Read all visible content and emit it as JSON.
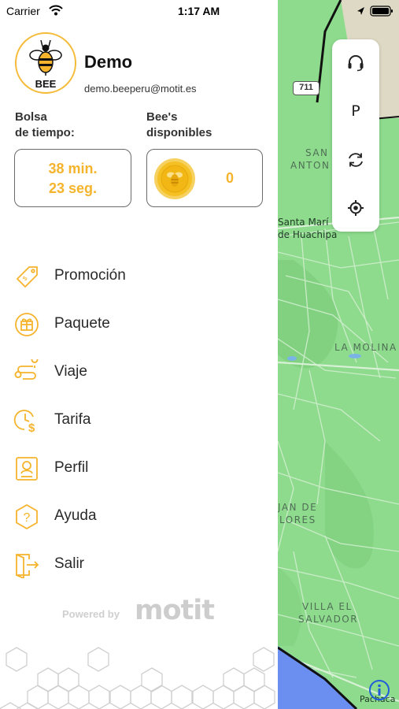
{
  "status_bar": {
    "carrier": "Carrier",
    "time": "1:17 AM"
  },
  "user": {
    "name": "Demo",
    "email": "demo.beeperu@motit.es",
    "logo_text": "BEE"
  },
  "stats": {
    "time_label_line1": "Bolsa",
    "time_label_line2": "de tiempo:",
    "time_minutes": "38 min.",
    "time_seconds": "23 seg.",
    "bees_label_line1": "Bee's",
    "bees_label_line2": "disponibles",
    "bees_count": "0"
  },
  "menu": {
    "items": [
      {
        "label": "Promoción",
        "icon": "promo-tag-icon"
      },
      {
        "label": "Paquete",
        "icon": "package-icon"
      },
      {
        "label": "Viaje",
        "icon": "route-icon"
      },
      {
        "label": "Tarifa",
        "icon": "clock-dollar-icon"
      },
      {
        "label": "Perfil",
        "icon": "profile-card-icon"
      },
      {
        "label": "Ayuda",
        "icon": "help-hexagon-icon"
      },
      {
        "label": "Salir",
        "icon": "exit-door-icon"
      }
    ]
  },
  "footer": {
    "powered_by": "Powered by",
    "brand": "motit"
  },
  "map": {
    "road_number": "711",
    "labels": {
      "san_antonio_1": "SAN",
      "san_antonio_2": "ANTON",
      "santa_maria_1": "Santa Marí",
      "santa_maria_2": "de Huachipa",
      "la_molina": "LA MOLINA",
      "juan_de_1": "JAN DE",
      "juan_de_2": "LORES",
      "villa_1": "VILLA EL",
      "villa_2": "SALVADOR",
      "pachacamac": "Pachaca"
    },
    "controls": {
      "parking_label": "P"
    }
  },
  "colors": {
    "accent": "#f5b42c",
    "map_green": "#8fdb8e",
    "map_road": "#cdeccd"
  }
}
